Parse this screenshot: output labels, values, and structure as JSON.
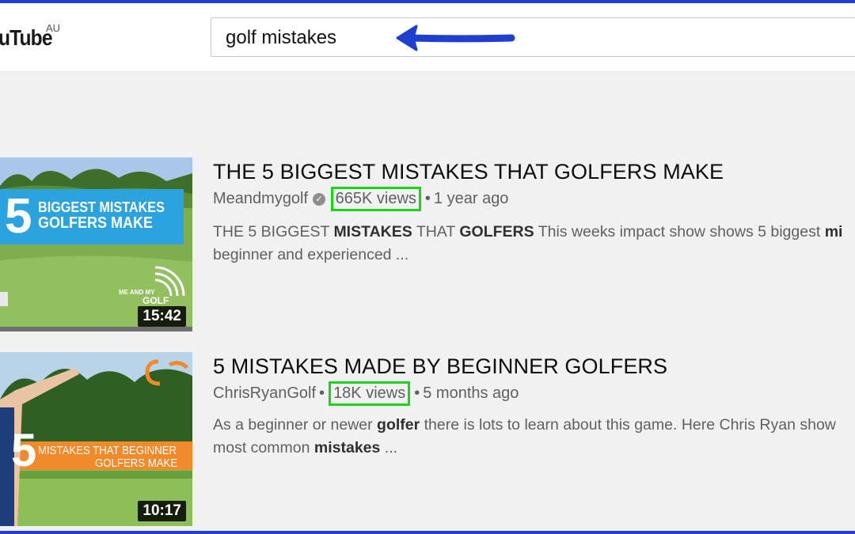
{
  "header": {
    "logo_text": "uTube",
    "region": "AU",
    "search_value": "golf mistakes"
  },
  "colors": {
    "frame_border": "#1f3fd1",
    "arrow": "#1f3fd1",
    "highlight": "#19d419"
  },
  "results": [
    {
      "title": "THE 5 BIGGEST MISTAKES THAT GOLFERS MAKE",
      "channel": "Meandmygolf",
      "verified": true,
      "views": "665K views",
      "age": "1 year ago",
      "desc_line1_parts": [
        "THE 5 BIGGEST ",
        "MISTAKES",
        " THAT ",
        "GOLFERS",
        " This weeks impact show shows 5 biggest ",
        "mi"
      ],
      "desc_line2": "beginner and experienced ...",
      "duration": "15:42",
      "thumb_text": {
        "number": "5",
        "line1": "BIGGEST MISTAKES",
        "line2": "GOLFERS MAKE",
        "brand_small": "ME AND MY",
        "brand": "GOLF"
      }
    },
    {
      "title": "5 MISTAKES MADE BY BEGINNER GOLFERS",
      "channel": "ChrisRyanGolf",
      "verified": false,
      "views": "18K views",
      "age": "5 months ago",
      "desc_line1_parts": [
        "As a beginner or newer ",
        "golfer",
        " there is lots to learn about this game. Here Chris Ryan show"
      ],
      "desc_line2_parts": [
        "most common ",
        "mistakes",
        " ..."
      ],
      "duration": "10:17",
      "thumb_text": {
        "number": "5",
        "line1": "MISTAKES THAT BEGINNER",
        "line2": "GOLFERS MAKE"
      }
    }
  ]
}
